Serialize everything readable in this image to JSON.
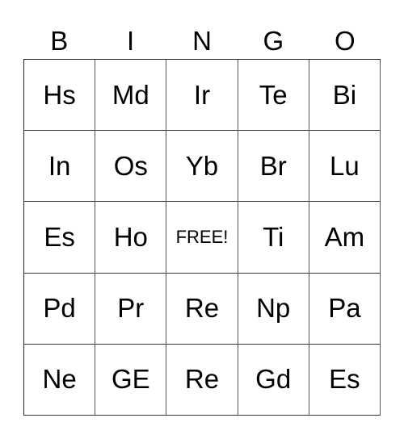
{
  "header": [
    "B",
    "I",
    "N",
    "G",
    "O"
  ],
  "rows": [
    [
      "Hs",
      "Md",
      "Ir",
      "Te",
      "Bi"
    ],
    [
      "In",
      "Os",
      "Yb",
      "Br",
      "Lu"
    ],
    [
      "Es",
      "Ho",
      "FREE!",
      "Ti",
      "Am"
    ],
    [
      "Pd",
      "Pr",
      "Re",
      "Np",
      "Pa"
    ],
    [
      "Ne",
      "GE",
      "Re",
      "Gd",
      "Es"
    ]
  ]
}
